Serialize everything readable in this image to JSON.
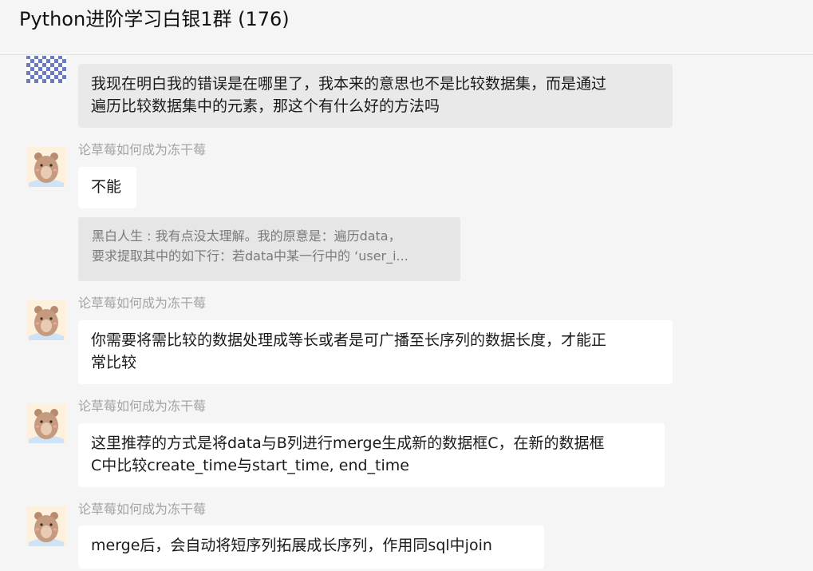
{
  "window": {
    "title": "Python进阶学习白银1群 (176)"
  },
  "messages": [
    {
      "sender": "",
      "avatar": "mosaic-avatar",
      "lines": [
        "我现在明白我的错误是在哪里了，我本来的意思也不是比较数据集，而是通过",
        "遍历比较数据集中的元素，那这个有什么好的方法吗"
      ]
    },
    {
      "sender": "论草莓如何成为冻干莓",
      "avatar": "bear-avatar",
      "lines": [
        "不能"
      ],
      "quote": [
        "黑白人生 : 我有点没太理解。我的原意是：遍历data，",
        "要求提取其中的如下行：若data中某一行中的 ‘user_i..."
      ]
    },
    {
      "sender": "论草莓如何成为冻干莓",
      "avatar": "bear-avatar",
      "lines": [
        "你需要将需比较的数据处理成等长或者是可广播至长序列的数据长度，才能正",
        "常比较"
      ]
    },
    {
      "sender": "论草莓如何成为冻干莓",
      "avatar": "bear-avatar",
      "lines": [
        "这里推荐的方式是将data与B列进行merge生成新的数据框C，在新的数据框",
        "C中比较create_time与start_time, end_time"
      ]
    },
    {
      "sender": "论草莓如何成为冻干莓",
      "avatar": "bear-avatar",
      "lines": [
        "merge后，会自动将短序列拓展成长序列，作用同sql中join"
      ]
    }
  ]
}
